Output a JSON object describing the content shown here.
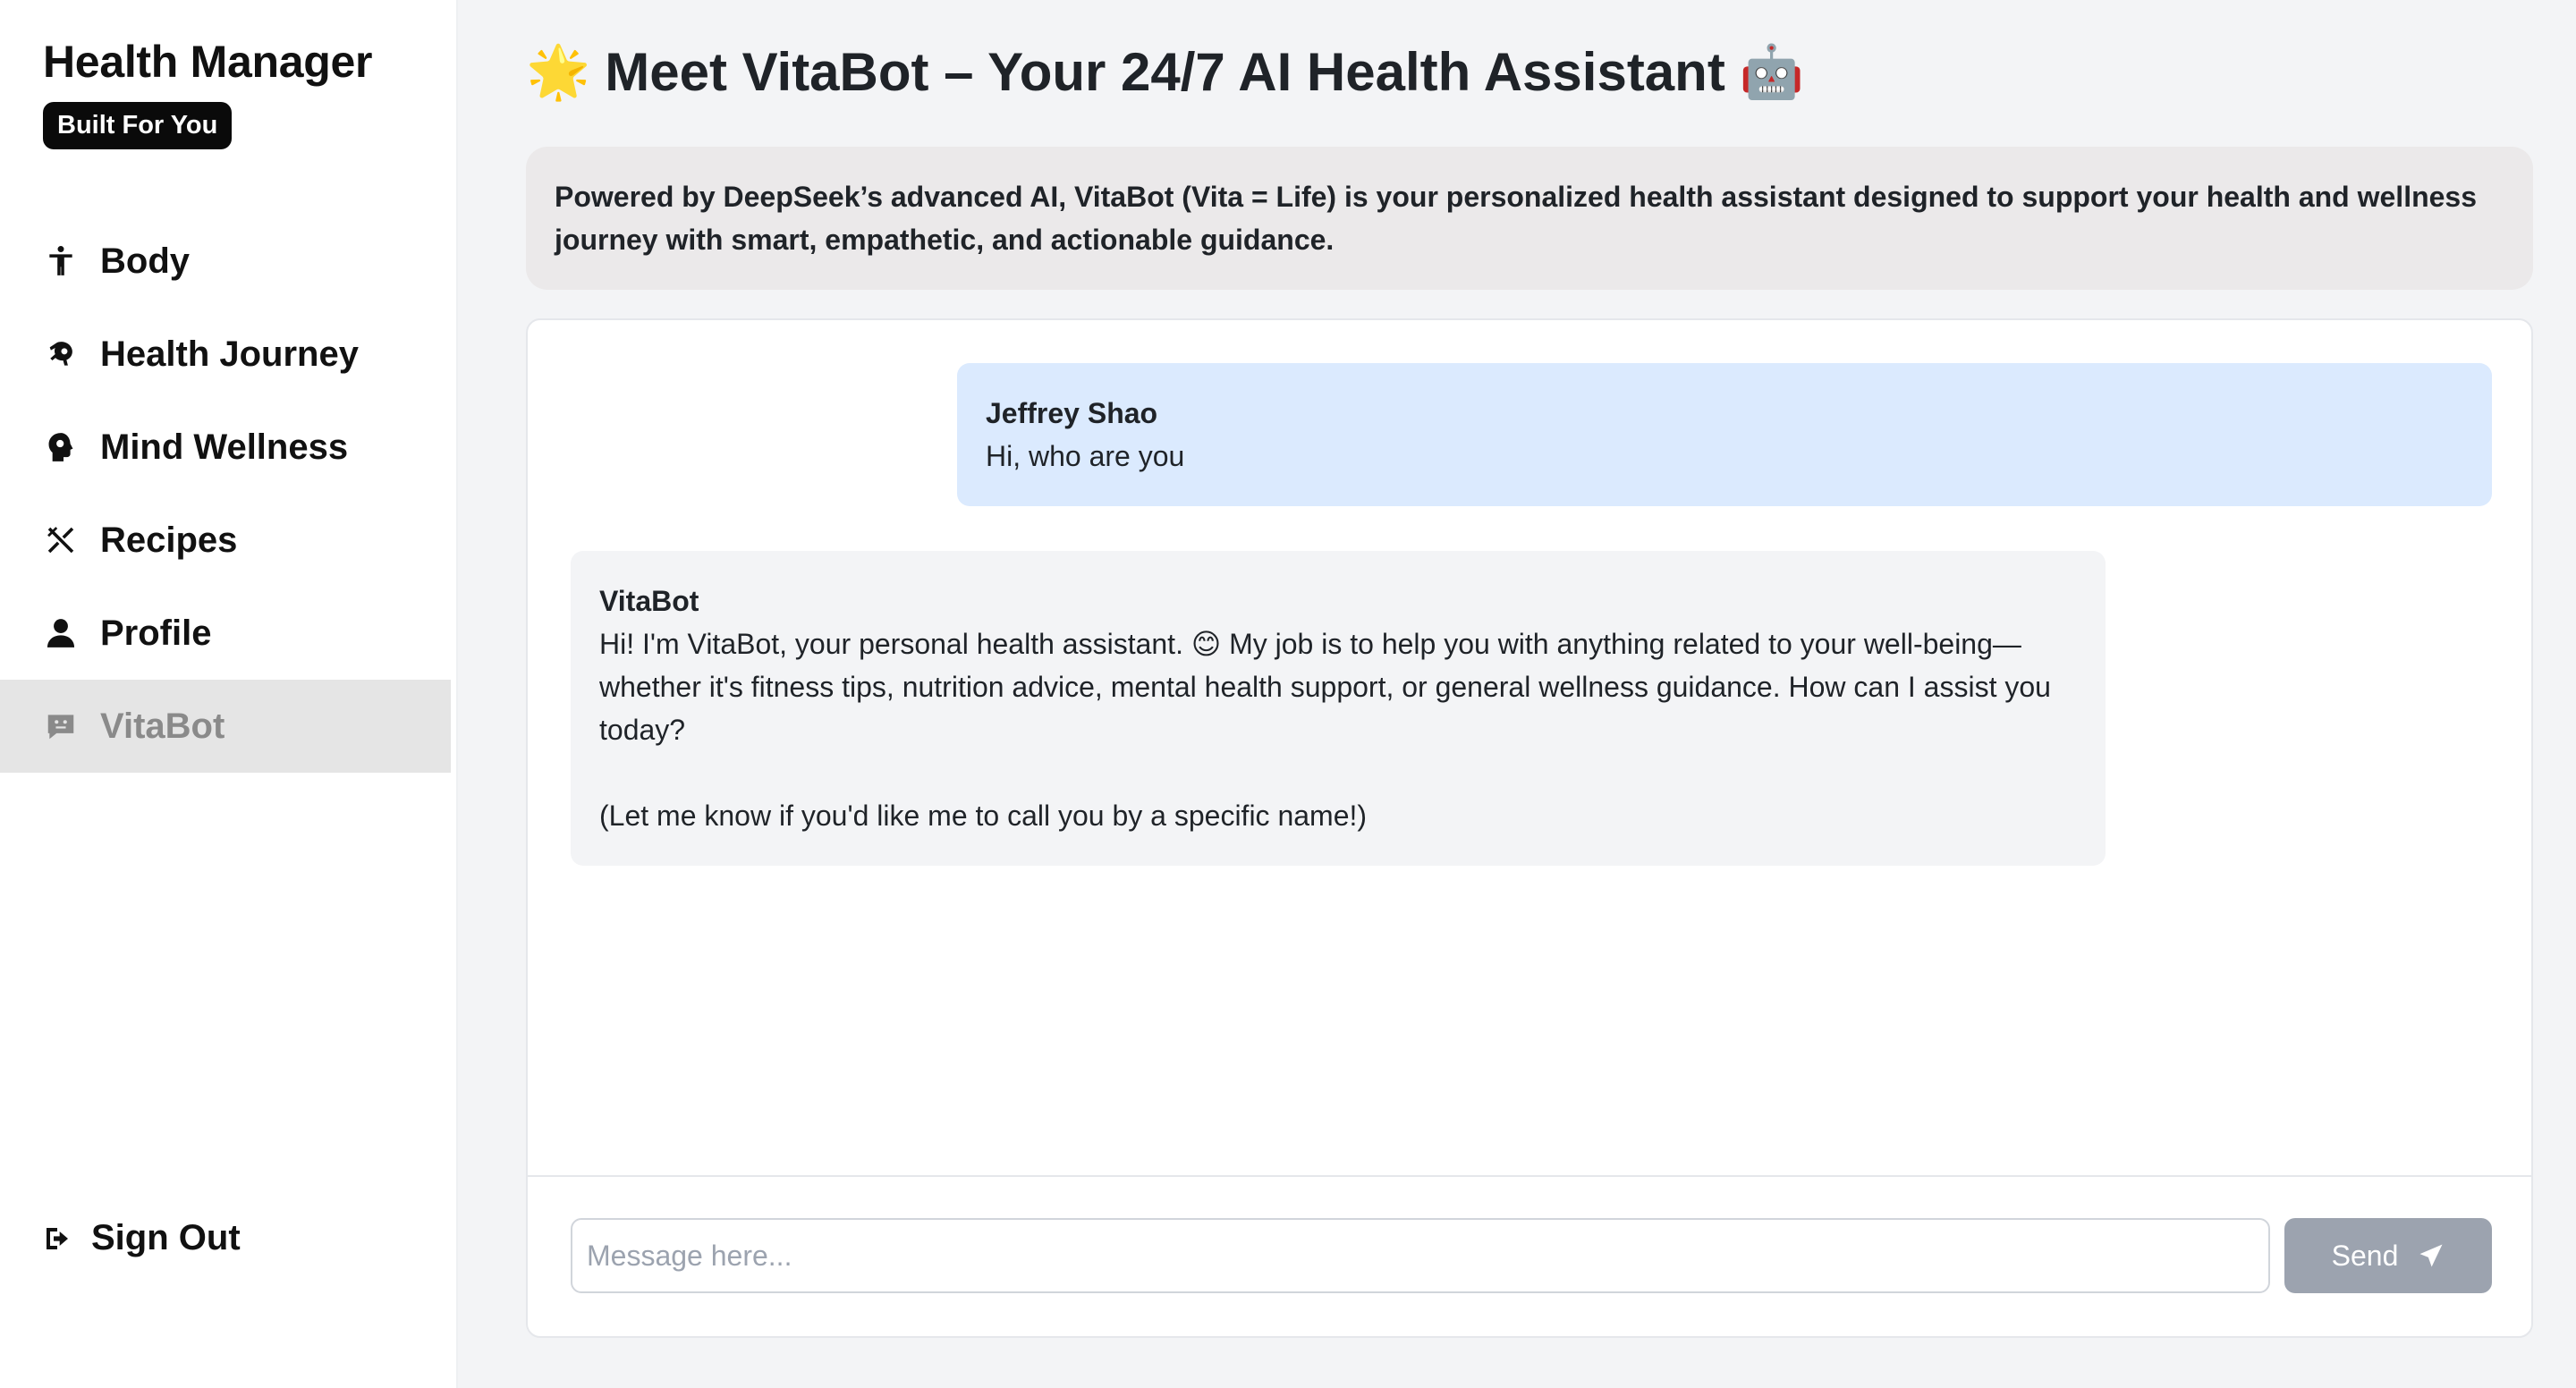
{
  "sidebar": {
    "brand_title": "Health Manager",
    "brand_badge": "Built For You",
    "items": [
      {
        "label": "Body",
        "icon": "person-standing-icon"
      },
      {
        "label": "Health Journey",
        "icon": "running-icon"
      },
      {
        "label": "Mind Wellness",
        "icon": "head-brain-icon"
      },
      {
        "label": "Recipes",
        "icon": "utensils-icon"
      },
      {
        "label": "Profile",
        "icon": "user-icon"
      },
      {
        "label": "VitaBot",
        "icon": "bot-chat-icon",
        "active": true
      }
    ],
    "signout_label": "Sign Out"
  },
  "header": {
    "title_prefix_emoji": "🌟",
    "title": "Meet VitaBot – Your 24/7 AI Health Assistant",
    "title_suffix_emoji": "🤖",
    "intro": "Powered by DeepSeek’s advanced AI, VitaBot (Vita = Life) is your personalized health assistant designed to support your health and wellness journey with smart, empathetic, and actionable guidance."
  },
  "chat": {
    "messages": [
      {
        "author": "Jeffrey Shao",
        "role": "user",
        "text": "Hi, who are you"
      },
      {
        "author": "VitaBot",
        "role": "bot",
        "text": "Hi! I'm VitaBot, your personal health assistant. 😊 My job is to help you with anything related to your well-being—whether it's fitness tips, nutrition advice, mental health support, or general wellness guidance. How can I assist you today?",
        "text_2": "(Let me know if you'd like me to call you by a specific name!)"
      }
    ],
    "input_placeholder": "Message here...",
    "input_value": "",
    "send_label": "Send"
  },
  "colors": {
    "active_nav_bg": "#e5e5e5",
    "user_bubble": "#dbeafe",
    "bot_bubble": "#f3f4f6",
    "send_button": "#9ca3af"
  }
}
